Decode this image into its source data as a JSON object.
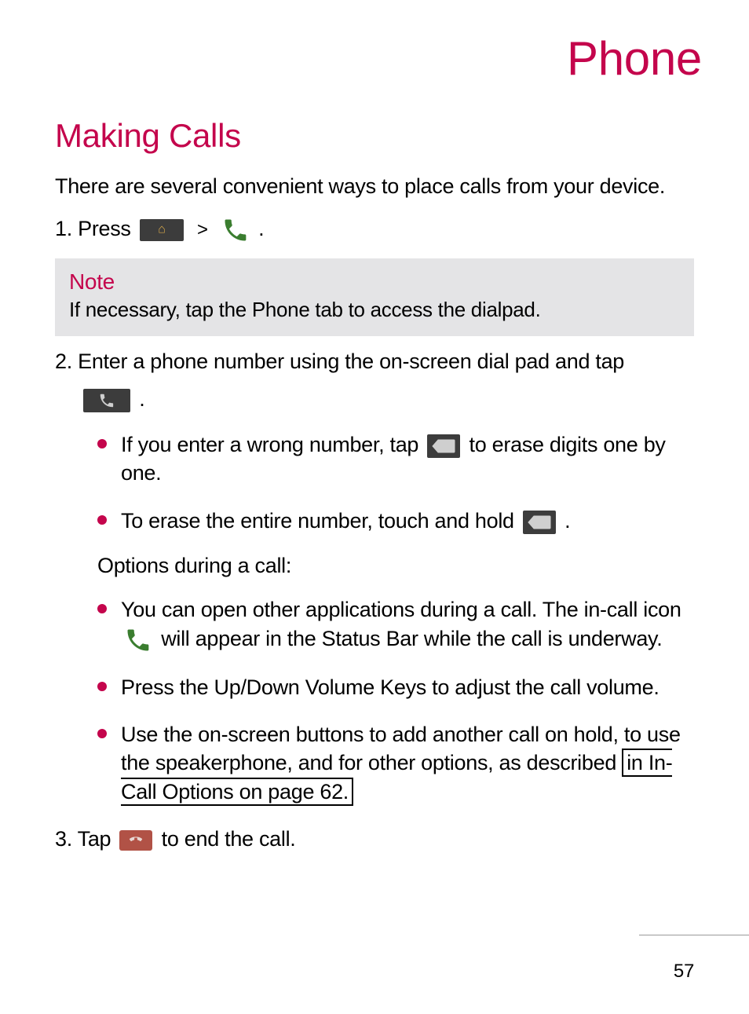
{
  "page_title": "Phone",
  "section_heading": "Making Calls",
  "intro": "There are several convenient ways to place calls from your device.",
  "step1_a": "1. Press ",
  "gt": ">",
  "period": ".",
  "note": {
    "title": "Note",
    "body": "If necessary, tap the Phone tab to access the dialpad."
  },
  "step2_a": "2. Enter a phone number using the on-screen dial pad and tap",
  "bullets1": {
    "b1_a": "If you enter a wrong number, tap ",
    "b1_b": " to erase digits one by one.",
    "b2_a": "To erase the entire number, touch and hold ",
    "b2_b": "."
  },
  "sub_heading": "Options during a call:",
  "bullets2": {
    "b1_a": "You can open other applications during a call. The in-call icon ",
    "b1_b": " will appear in the Status Bar while the call is underway.",
    "b2": "Press the Up/Down Volume Keys to adjust the call volume.",
    "b3_a": "Use the on-screen buttons to add another call on hold, to use the speakerphone, and for other options, as described ",
    "b3_link": "in In-Call Options on page 62."
  },
  "step3_a": "3. Tap ",
  "step3_b": " to end the call.",
  "page_number": "57"
}
